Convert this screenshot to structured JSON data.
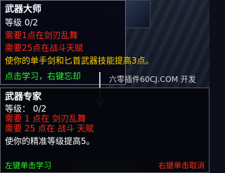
{
  "tooltip_master": {
    "title": "武器大师",
    "rank": "等级 0/2",
    "req1": "需要1点在剑刃乱舞",
    "req2": "需要25点在战斗天赋",
    "description": "使你的单手剑和匕首武器技能提高3点。",
    "hint": "点击学习，右键忘却"
  },
  "tooltip_expert": {
    "title": "武器专家",
    "rank": "等级： 0/2",
    "req1": "需要 1 点在 剑刃乱舞",
    "req2": "需要 25 点在 战斗 天赋",
    "description": "使你的精准等级提高5。",
    "hint_left": "左键单击学习",
    "hint_right": "右键单击取消"
  },
  "watermark": "六零插件60CJ.COM 开发",
  "colors": {
    "title": "#ffffff",
    "requirement": "#ff2a1a",
    "description": "#ffd200",
    "hint": "#20ff20"
  }
}
